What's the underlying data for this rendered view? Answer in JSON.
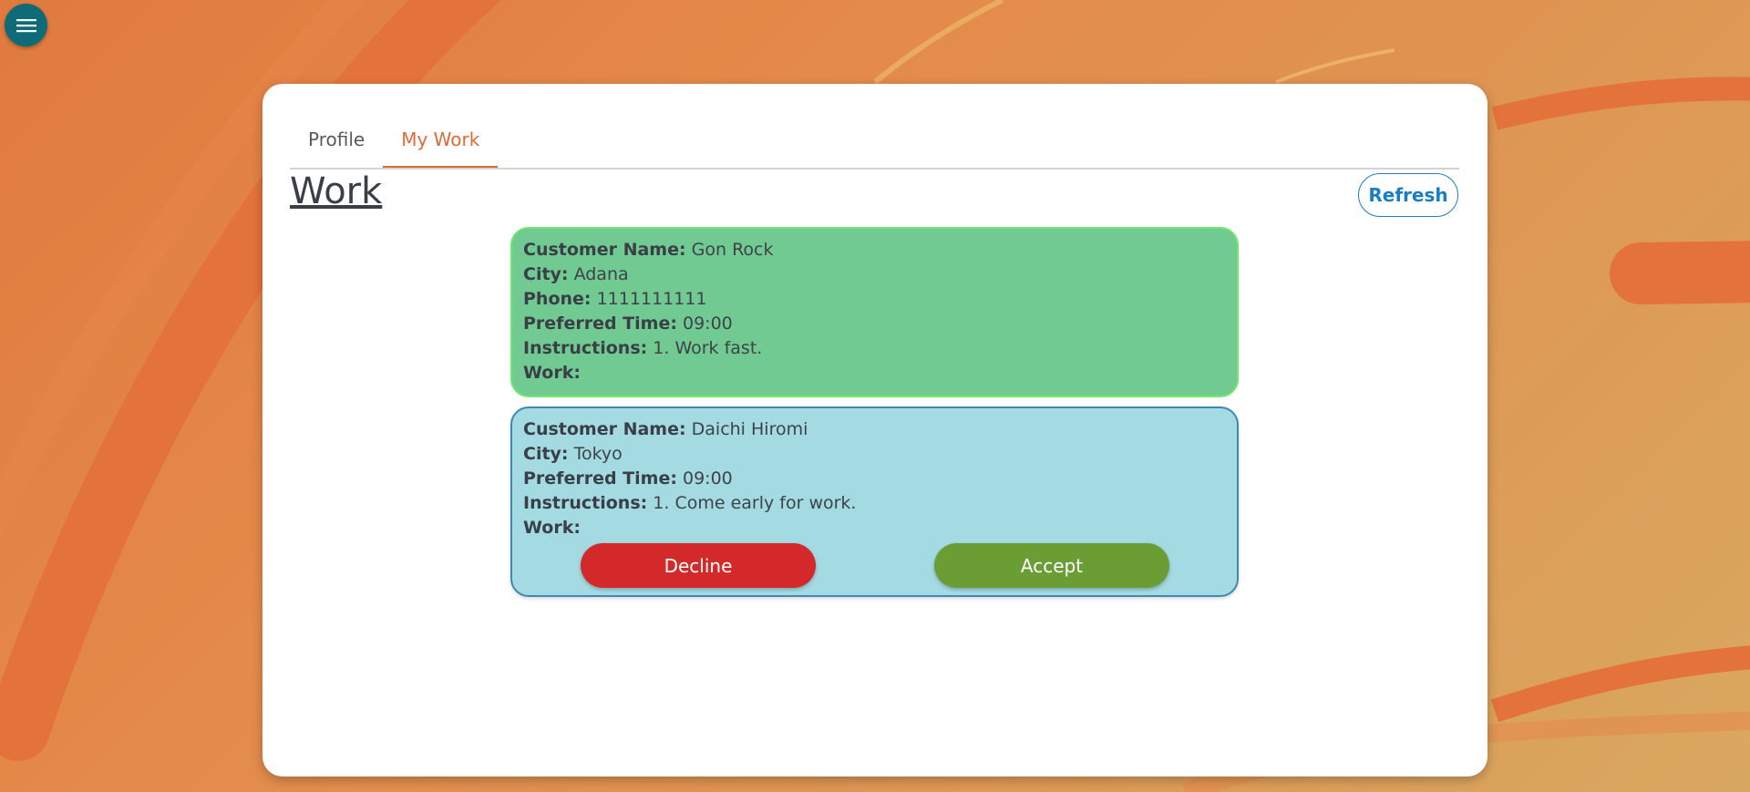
{
  "tabs": [
    {
      "label": "Profile",
      "active": false
    },
    {
      "label": "My Work",
      "active": true
    }
  ],
  "page_title": "Work",
  "refresh_label": "Refresh",
  "jobs": [
    {
      "status": "accepted",
      "fields": [
        {
          "label": "Customer Name:",
          "value": "Gon Rock"
        },
        {
          "label": "City:",
          "value": "Adana"
        },
        {
          "label": "Phone:",
          "value": "1111111111"
        },
        {
          "label": "Preferred Time:",
          "value": "09:00"
        },
        {
          "label": "Instructions:",
          "value": "1. Work fast."
        },
        {
          "label": "Work:",
          "value": ""
        }
      ]
    },
    {
      "status": "pending",
      "fields": [
        {
          "label": "Customer Name:",
          "value": "Daichi Hiromi"
        },
        {
          "label": "City:",
          "value": "Tokyo"
        },
        {
          "label": "Preferred Time:",
          "value": "09:00"
        },
        {
          "label": "Instructions:",
          "value": "1. Come early for work."
        },
        {
          "label": "Work:",
          "value": ""
        }
      ],
      "decline_label": "Decline",
      "accept_label": "Accept"
    }
  ],
  "icons": {
    "menu": "hamburger-menu-icon"
  },
  "colors": {
    "accent": "#de6b34",
    "menu_button": "#0e6b78",
    "accepted_card": "#71ca91",
    "pending_card": "#a4dbe3",
    "decline": "#d4292a",
    "accept": "#6a9e34",
    "refresh": "#1a7fc2"
  }
}
